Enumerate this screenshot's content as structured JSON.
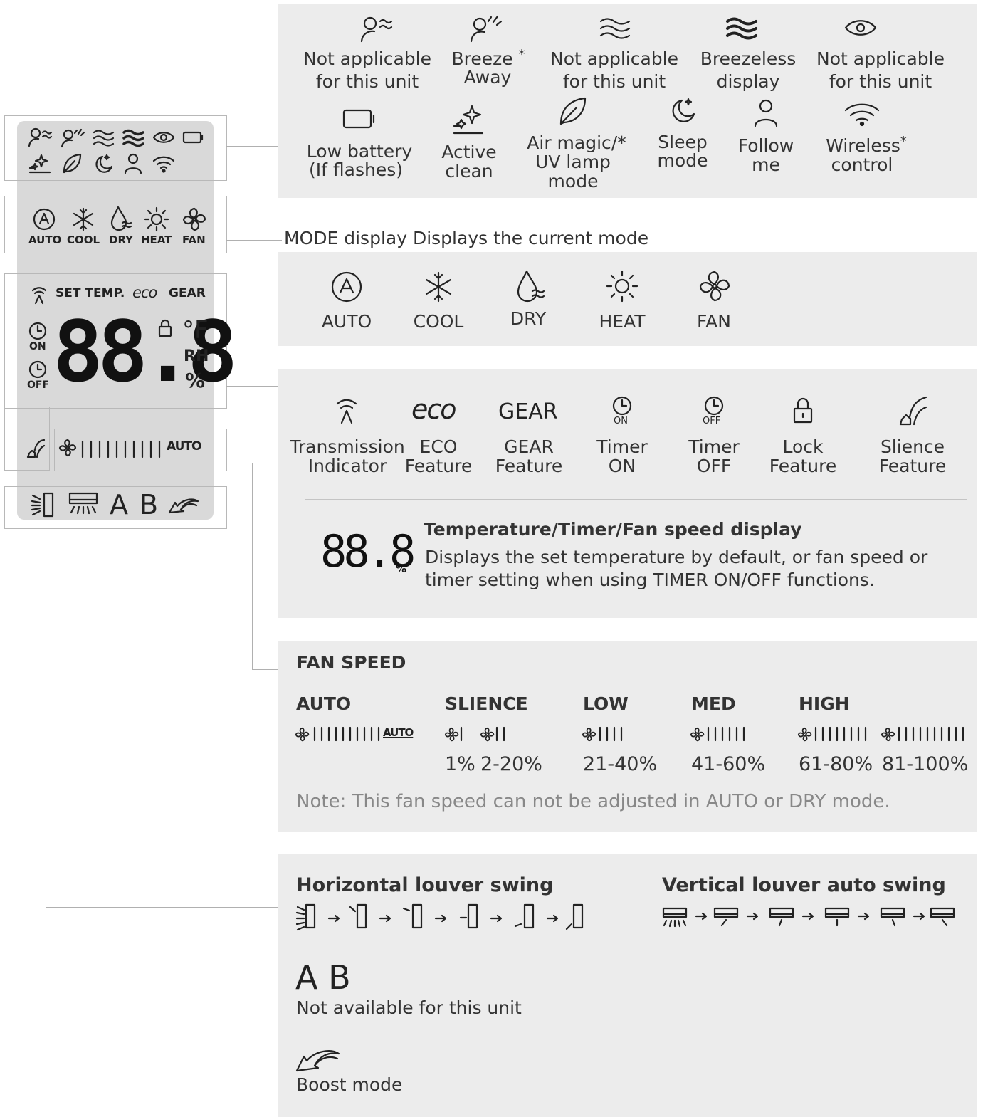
{
  "top_features": [
    {
      "icon": "person-wind-icon",
      "label1": "Not applicable",
      "label2": "for this unit",
      "sup": ""
    },
    {
      "icon": "breeze-away-icon",
      "label1": "Breeze",
      "label2": "Away",
      "sup": "*"
    },
    {
      "icon": "wind-waves-icon",
      "label1": "Not applicable",
      "label2": "for this unit",
      "sup": ""
    },
    {
      "icon": "breezeless-icon",
      "label1": "Breezeless",
      "label2": "display",
      "sup": ""
    },
    {
      "icon": "eye-icon",
      "label1": "Not applicable",
      "label2": "for this unit",
      "sup": ""
    }
  ],
  "second_features": [
    {
      "icon": "battery-icon",
      "label1": "Low battery",
      "label2": "(If flashes)",
      "label3": ""
    },
    {
      "icon": "sparkle-clean-icon",
      "label1": "Active",
      "label2": "clean",
      "label3": ""
    },
    {
      "icon": "leaf-icon",
      "label1": "Air magic/*",
      "label2": "UV  lamp",
      "label3": "mode"
    },
    {
      "icon": "moon-icon",
      "label1": "Sleep",
      "label2": "mode",
      "label3": ""
    },
    {
      "icon": "person-icon",
      "label1": "Follow",
      "label2": "me",
      "label3": ""
    },
    {
      "icon": "wifi-icon",
      "label1": "Wireless",
      "label2": "control",
      "label3": "",
      "sup": "*"
    }
  ],
  "mode_header": "MODE display Displays the current mode",
  "modes": [
    "AUTO",
    "COOL",
    "DRY",
    "HEAT",
    "FAN"
  ],
  "lcd": {
    "modes": [
      "AUTO",
      "COOL",
      "DRY",
      "HEAT",
      "FAN"
    ],
    "set_temp": "SET TEMP.",
    "eco": "eco",
    "gear": "GEAR",
    "on": "ON",
    "off": "OFF",
    "digits": "88.8",
    "unit_f": "°F",
    "rh": "RH",
    "percent": "%",
    "fan_auto": "AUTO",
    "a": "A",
    "b": "B"
  },
  "indicators": [
    {
      "icon": "transmission-icon",
      "label1": "Transmission",
      "label2": "Indicator"
    },
    {
      "icon": "eco-icon",
      "label1": "ECO",
      "label2": "Feature"
    },
    {
      "icon": "gear-text-icon",
      "label1": "GEAR",
      "label2": "Feature",
      "glyph": "GEAR"
    },
    {
      "icon": "timer-on-icon",
      "label1": "Timer",
      "label2": "ON",
      "sub": "ON"
    },
    {
      "icon": "timer-off-icon",
      "label1": "Timer",
      "label2": "OFF",
      "sub": "OFF"
    },
    {
      "icon": "lock-icon",
      "label1": "Lock",
      "label2": "Feature"
    },
    {
      "icon": "silence-icon",
      "label1": "Slience",
      "label2": "Feature"
    }
  ],
  "display_block": {
    "digits": "88.8",
    "percent": "%",
    "title": "Temperature/Timer/Fan speed display",
    "desc1": "Displays the set temperature by default, or fan speed or",
    "desc2": "timer setting when using TIMER ON/OFF functions."
  },
  "fan_speed": {
    "title": "FAN SPEED",
    "columns": [
      "AUTO",
      "SLIENCE",
      "LOW",
      "MED",
      "HIGH"
    ],
    "auto_tag": "AUTO",
    "percents": [
      "1%",
      "2-20%",
      "21-40%",
      "41-60%",
      "61-80%",
      "81-100%"
    ],
    "bars": [
      1,
      2,
      4,
      6,
      8,
      10
    ],
    "note": "Note: This fan speed can not be adjusted in AUTO or DRY mode."
  },
  "louver": {
    "h_title": "Horizontal louver swing",
    "v_title": "Vertical louver auto swing",
    "ab": "A B",
    "ab_desc": "Not available for this unit",
    "boost": "Boost mode"
  },
  "colors": {
    "panel": "#ececec",
    "lcd": "#d9d9d9",
    "text": "#333333",
    "note": "#888888"
  }
}
